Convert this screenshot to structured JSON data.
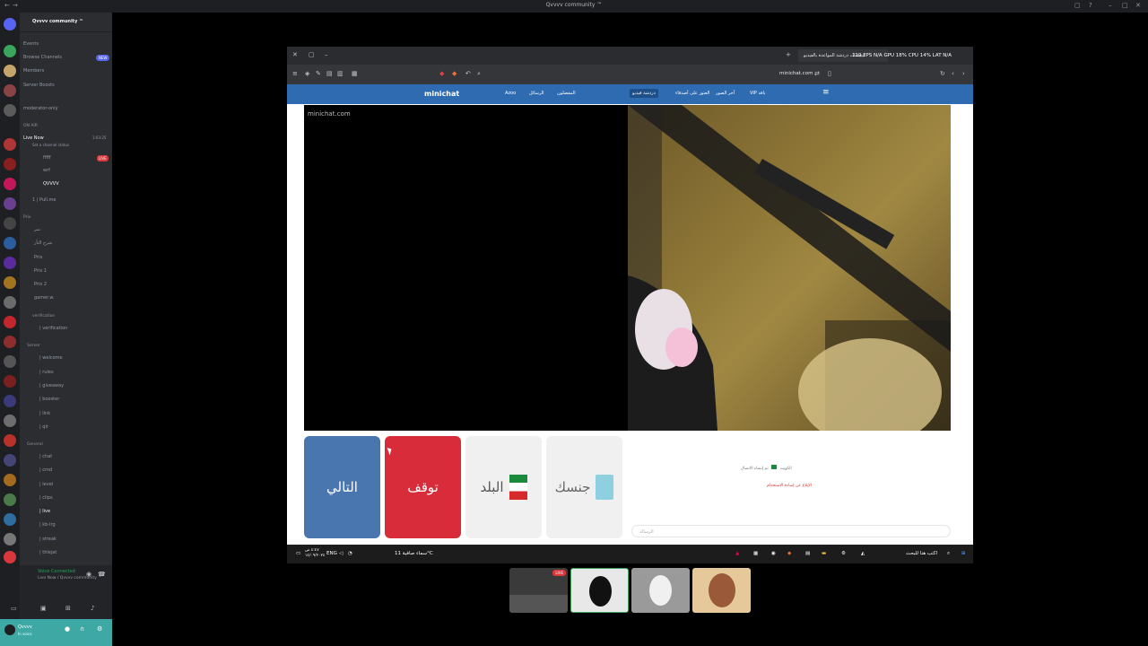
{
  "discord": {
    "window_title": "Qvvvv community ™",
    "guild_name": "Qvvvv community ™",
    "nav": [
      {
        "label": "Events"
      },
      {
        "label": "Browse Channels",
        "badge": "NEW"
      },
      {
        "label": "Members"
      },
      {
        "label": "Server Boosts"
      }
    ],
    "channels_top": [
      {
        "label": "moderator-only"
      }
    ],
    "on_air": {
      "category": "ON AIR",
      "live_channel": "Live Now",
      "live_sub": "Set a channel status",
      "live_time": "1:03:25",
      "users": [
        "fffff",
        "wrf",
        "QVVVV"
      ],
      "live_badge": "LIVE",
      "extra": "1 | Pull.me"
    },
    "prix": {
      "category": "Prix",
      "items": [
        "نمر",
        "شرح الثأر",
        "Prix",
        "Prix 1",
        "Prix 2",
        "gamer.w."
      ]
    },
    "verification": {
      "category": "verification",
      "items": [
        "| verification"
      ]
    },
    "server": {
      "category": "Server",
      "items": [
        "| welcome",
        "| rules",
        "| giveaway",
        "| booster",
        "| link",
        "| qlr"
      ]
    },
    "general": {
      "category": "General",
      "items": [
        "| chat",
        "| cmd",
        "| level",
        "| clips",
        "| live",
        "| kb-lrg",
        "| streak",
        "| thlejat"
      ]
    },
    "voice": {
      "status": "Voice Connected",
      "channel": "Live Now / Qvvvv community ™"
    },
    "user": {
      "name": "Qvvvv",
      "status": "In voice"
    }
  },
  "browser": {
    "tab_title": "مينيشات دردشة المواعدة بالفيديو",
    "url": "minichat.com",
    "hud": "119 FPS N/A   GPU 18%   CPU 14%   LAT N/A"
  },
  "minichat": {
    "logo": "minichat",
    "watermark": "minichat.com",
    "nav": [
      {
        "label": "VIP باقة"
      },
      {
        "label": "آخر الصور"
      },
      {
        "label": "العثور على أصدقاء"
      },
      {
        "label": "دردشة فيديو",
        "active": true
      },
      {
        "label": "المفضلون"
      },
      {
        "label": "الرسائل"
      },
      {
        "label": "Azoo"
      }
    ],
    "buttons": {
      "next": "التالي",
      "stop": "توقف",
      "country": "البلد",
      "gender": "جنسك"
    },
    "chat": {
      "connected_msg": "تم إنشاء الاتصال",
      "country_name": "الكويت",
      "report": "الإبلاغ عن إساءة الاستخدام",
      "input_placeholder": "الرسالة"
    },
    "colors": {
      "header": "#2f6bb0",
      "next": "#4a76b0",
      "stop": "#d92c3a"
    }
  },
  "taskbar": {
    "search": "اكتب هنا للبحث",
    "weather": "سماء صافية  11°C",
    "lang": "ENG",
    "time": "٤:٤٧ ص",
    "date": "١٤/٠٩/٢٠٢٤"
  },
  "streams": {
    "live_badge": "LIVE"
  }
}
